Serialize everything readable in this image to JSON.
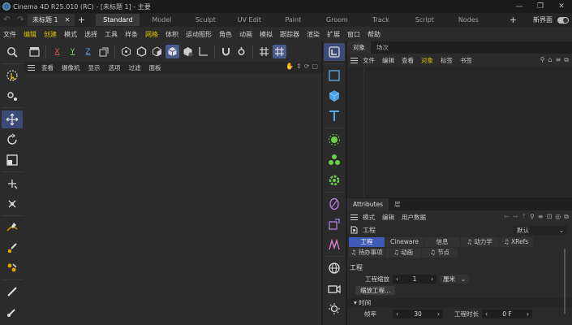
{
  "window": {
    "title": "Cinema 4D R25.010 (RC) - [未标题 1] - 主要",
    "controls": [
      "—",
      "❐",
      "✕"
    ]
  },
  "tabbar": {
    "doc_tab": "未标题 1",
    "doc_close": "✕",
    "plus": "+",
    "layouts": [
      "Standard",
      "Model",
      "Sculpt",
      "UV Edit",
      "Paint",
      "Groom",
      "Track",
      "Script",
      "Nodes"
    ],
    "new_ui_label": "新界面",
    "layout_plus": "+"
  },
  "menubar": {
    "items": [
      "文件",
      "编辑",
      "创建",
      "模式",
      "选择",
      "工具",
      "样条",
      "网格",
      "体积",
      "运动图形",
      "角色",
      "动画",
      "模拟",
      "跟踪器",
      "渲染",
      "扩展",
      "窗口",
      "帮助"
    ]
  },
  "viewport": {
    "axis_x": "X",
    "axis_y": "Y",
    "axis_z": "Z",
    "menu": [
      "查看",
      "摄像机",
      "显示",
      "选项",
      "过滤",
      "面板"
    ]
  },
  "object_manager": {
    "tabs": [
      "对象",
      "场次"
    ],
    "menu": [
      "文件",
      "编辑",
      "查看",
      "对象",
      "标签",
      "书签"
    ]
  },
  "attributes": {
    "tabs": [
      "Attributes",
      "层"
    ],
    "menu": [
      "模式",
      "编辑",
      "用户数据"
    ],
    "context_label": "工程",
    "preset_dropdown": "默认",
    "tabs_row1": [
      "工程",
      "Cineware",
      "信息",
      "动力学",
      "XRefs"
    ],
    "tabs_row2": [
      "待办事项",
      "动画",
      "节点"
    ],
    "section_title": "工程",
    "scale_label": "工程缩放",
    "scale_value": "1",
    "unit_value": "厘米",
    "scale_button": "缩放工程...",
    "time_group": "时间",
    "fps_label": "帧率",
    "fps_value": "30",
    "duration_label": "工程时长",
    "duration_value": "0 F"
  },
  "colors": {
    "accent_blue": "#3f5bb5",
    "highlight_yellow": "#d8c200",
    "axis_x": "#e05555",
    "axis_y": "#7dd36a",
    "axis_z": "#5a9de0"
  }
}
